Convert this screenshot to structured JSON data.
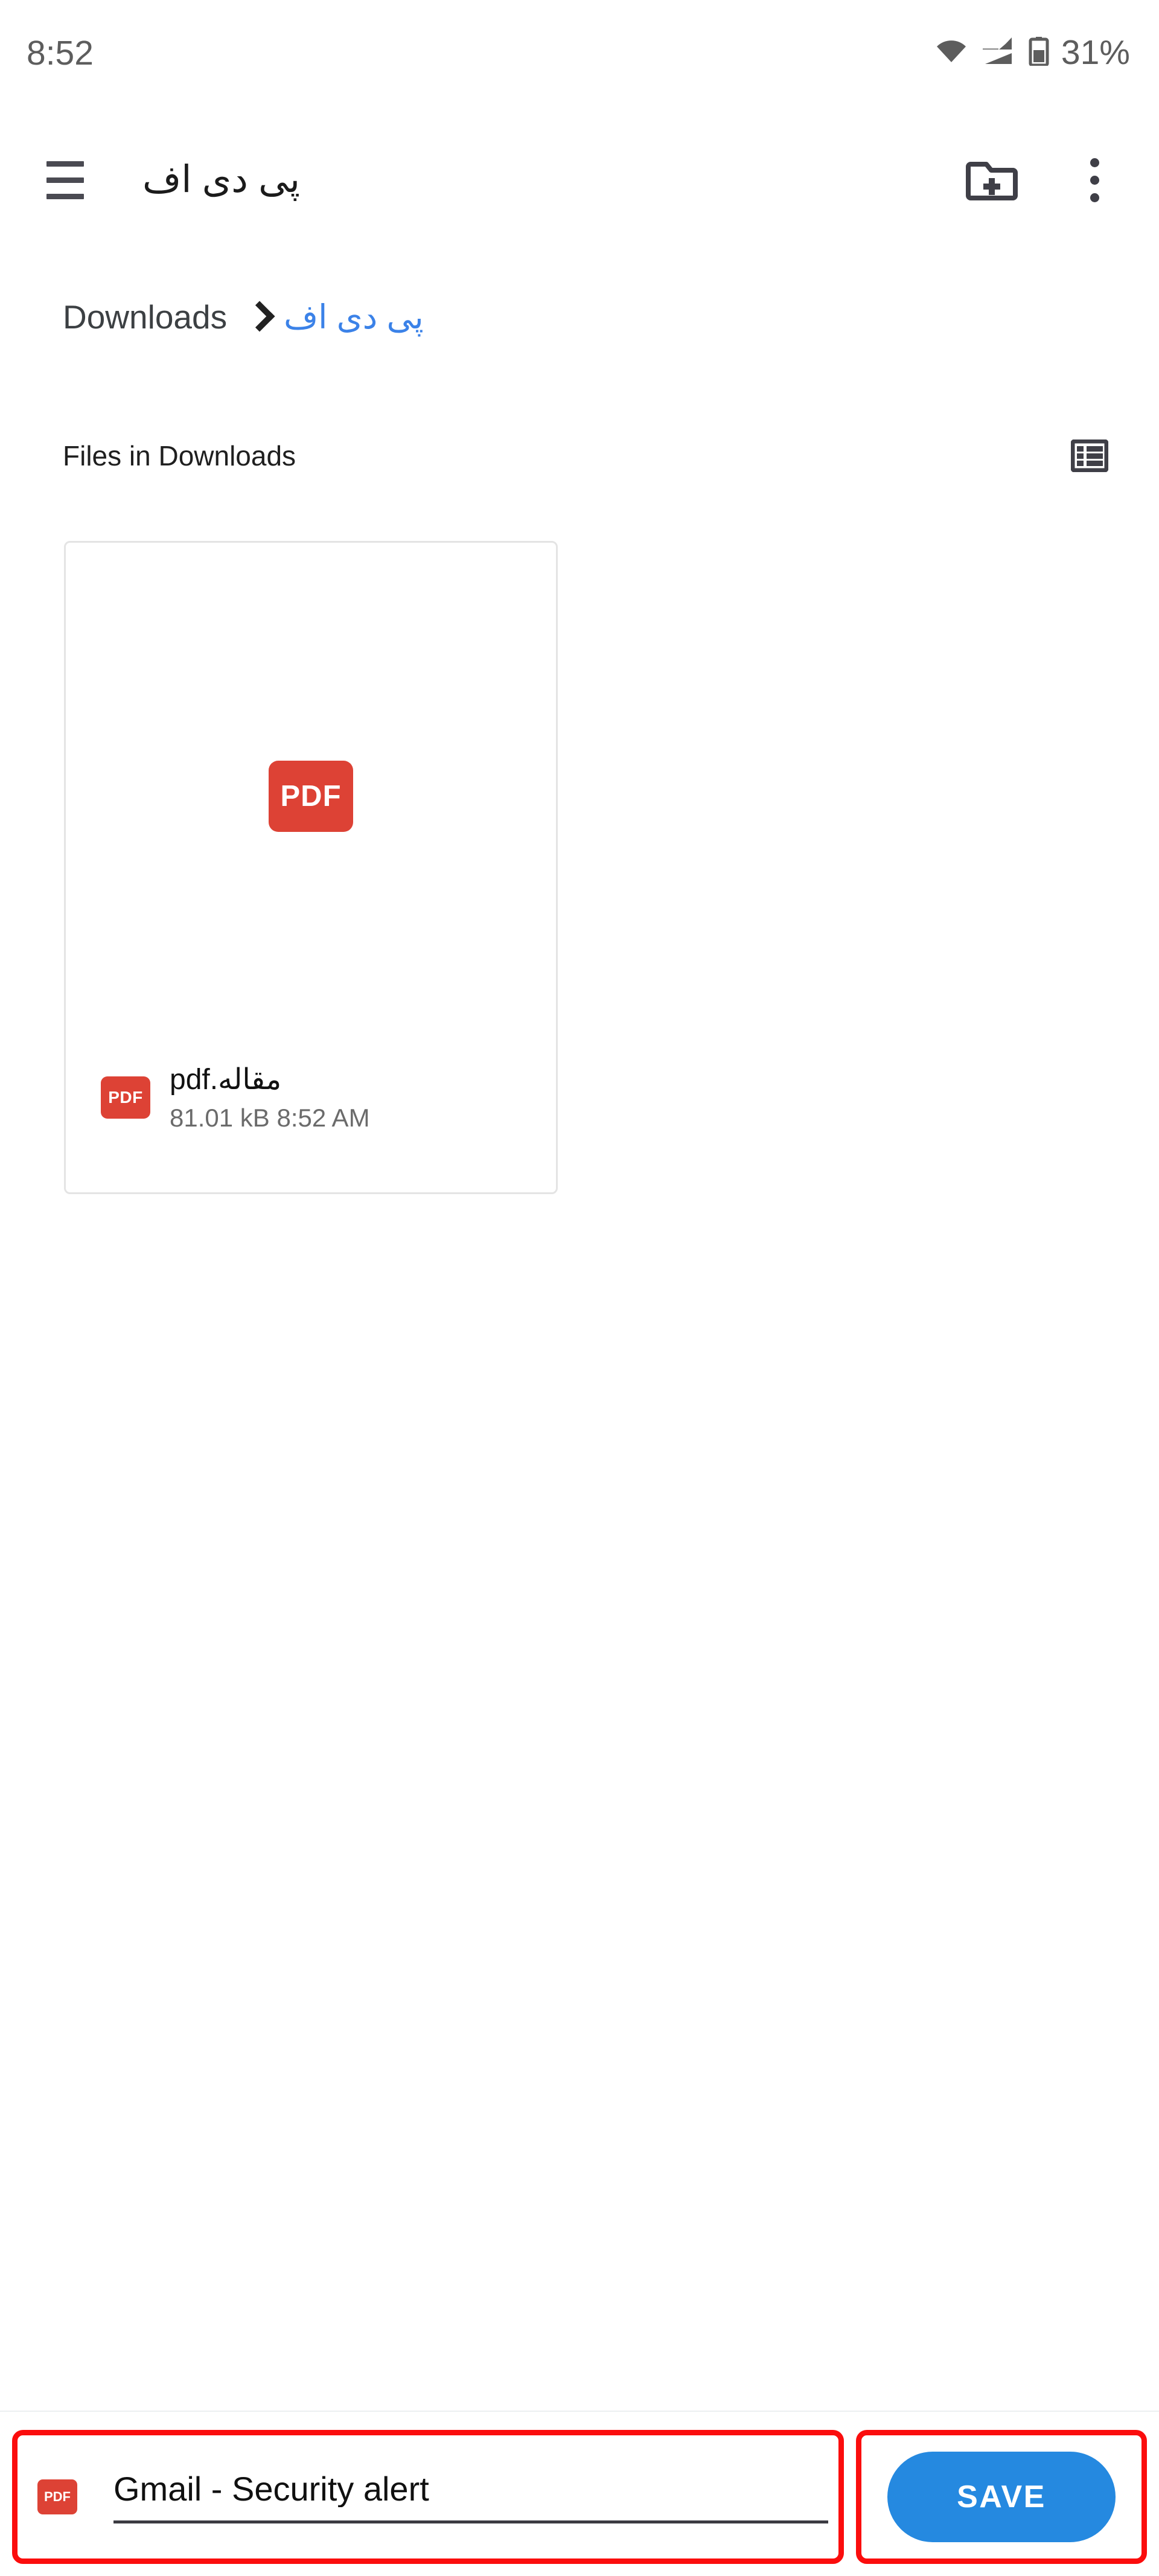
{
  "statusbar": {
    "time": "8:52",
    "battery_percent": "31%",
    "icons": [
      "wifi-icon",
      "cellular-signal-icon",
      "battery-icon"
    ]
  },
  "appbar": {
    "menu_icon": "hamburger-menu-icon",
    "title": "پی دی اف",
    "new_folder_icon": "create-new-folder-icon",
    "overflow_icon": "more-options-icon"
  },
  "breadcrumb": {
    "root": "Downloads",
    "separator": "chevron-right-icon",
    "current": "پی دی اف"
  },
  "section": {
    "title": "Files in Downloads",
    "view_toggle_icon": "list-view-icon"
  },
  "files": [
    {
      "thumb_label": "PDF",
      "badge_label": "PDF",
      "name": "مقاله.pdf",
      "size": "81.01 kB",
      "time": "8:52 AM",
      "subtitle": "81.01 kB  8:52 AM"
    }
  ],
  "bottombar": {
    "file_type_badge": "PDF",
    "filename_value": "Gmail - Security alert",
    "filename_placeholder": "File name",
    "save_label": "SAVE"
  },
  "colors": {
    "pdf_red": "#dd4235",
    "accent_blue": "#2589e0",
    "link_blue": "#3b82e8",
    "annotation_red": "#fb0d0d",
    "status_gray": "#5d5d5d"
  }
}
